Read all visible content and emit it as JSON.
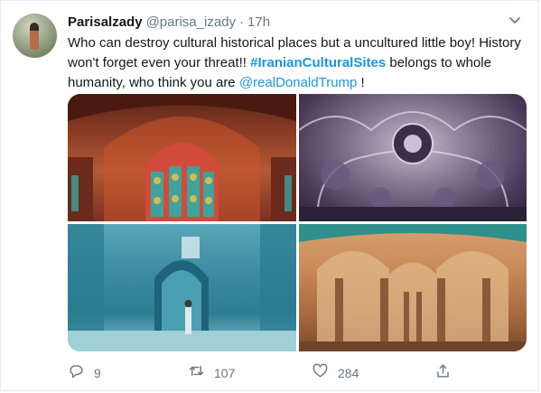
{
  "tweet": {
    "display_name": "Parisalzady",
    "handle": "@parisa_izady",
    "separator": "·",
    "timestamp": "17h",
    "text_part1": "Who can destroy cultural historical places but a uncultured little boy! History won't forget even your threat!! ",
    "hashtag": "#IranianCulturalSites",
    "text_part2": " belongs to whole humanity, who think you are ",
    "mention": "@realDonaldTrump",
    "text_part3": " !"
  },
  "actions": {
    "reply_count": "9",
    "retweet_count": "107",
    "like_count": "284"
  },
  "icons": {
    "more": "chevron-down-icon",
    "reply": "reply-icon",
    "retweet": "retweet-icon",
    "like": "heart-icon",
    "share": "share-icon"
  },
  "colors": {
    "link": "#1b95e0",
    "secondary_text": "#657786",
    "primary_text": "#14171a"
  }
}
